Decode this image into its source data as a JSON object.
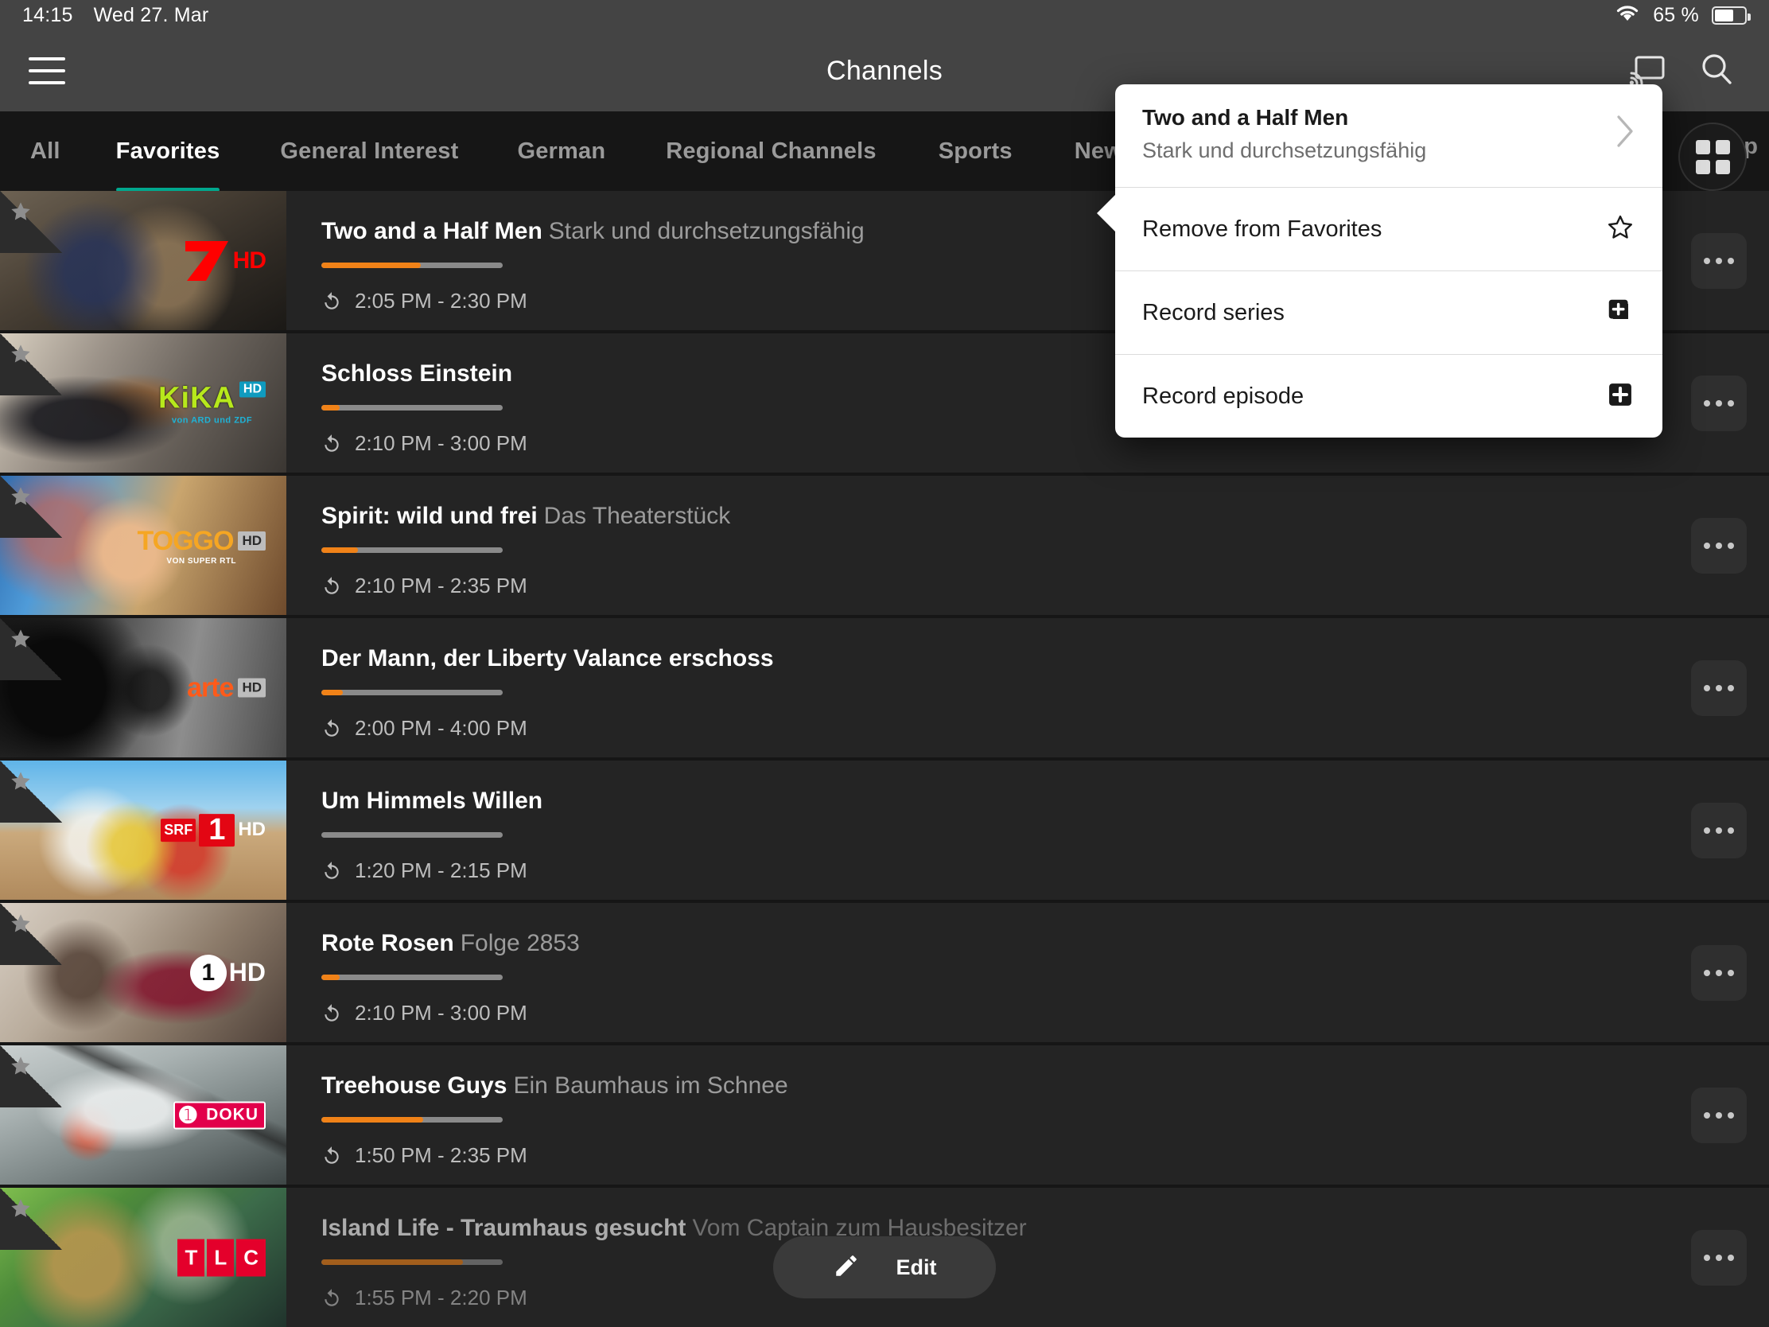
{
  "statusbar": {
    "time": "14:15",
    "date": "Wed 27. Mar",
    "battery_pct": "65 %",
    "wifi_icon": "wifi-icon",
    "battery_icon": "battery-icon"
  },
  "header": {
    "title": "Channels",
    "menu_icon": "hamburger-menu-icon",
    "cast_icon": "cast-icon",
    "search_icon": "search-icon"
  },
  "tabs": {
    "items": [
      {
        "label": "All",
        "active": false
      },
      {
        "label": "Favorites",
        "active": true
      },
      {
        "label": "General Interest",
        "active": false
      },
      {
        "label": "German",
        "active": false
      },
      {
        "label": "Regional Channels",
        "active": false
      },
      {
        "label": "Sports",
        "active": false
      },
      {
        "label": "News",
        "active": false
      }
    ],
    "overflow_label": "Sp",
    "grid_toggle_icon": "grid-view-icon",
    "accent_color": "#00a88e"
  },
  "list": {
    "rows": [
      {
        "title": "Two and a Half Men",
        "subtitle": "Stark und durchsetzungsfähig",
        "time": "2:05 PM - 2:30 PM",
        "progress_pct": 55,
        "channel": "pro7hd",
        "favorite_icon": "star-icon",
        "replay_icon": "replay-icon",
        "more_icon": "more-options-icon"
      },
      {
        "title": "Schloss Einstein",
        "subtitle": "",
        "time": "2:10 PM - 3:00 PM",
        "progress_pct": 10,
        "channel": "kikahd",
        "favorite_icon": "star-icon",
        "replay_icon": "replay-icon",
        "more_icon": "more-options-icon"
      },
      {
        "title": "Spirit: wild und frei",
        "subtitle": "Das Theaterstück",
        "time": "2:10 PM - 2:35 PM",
        "progress_pct": 20,
        "channel": "toggohd",
        "favorite_icon": "star-icon",
        "replay_icon": "replay-icon",
        "more_icon": "more-options-icon"
      },
      {
        "title": "Der Mann, der Liberty Valance erschoss",
        "subtitle": "",
        "time": "2:00 PM - 4:00 PM",
        "progress_pct": 12,
        "channel": "artehd",
        "favorite_icon": "star-icon",
        "replay_icon": "replay-icon",
        "more_icon": "more-options-icon"
      },
      {
        "title": "Um Himmels Willen",
        "subtitle": "",
        "time": "1:20 PM - 2:15 PM",
        "progress_pct": 0,
        "channel": "srf1hd",
        "favorite_icon": "star-icon",
        "replay_icon": "replay-icon",
        "more_icon": "more-options-icon"
      },
      {
        "title": "Rote Rosen",
        "subtitle": "Folge 2853",
        "time": "2:10 PM - 3:00 PM",
        "progress_pct": 10,
        "channel": "ardhd",
        "favorite_icon": "star-icon",
        "replay_icon": "replay-icon",
        "more_icon": "more-options-icon"
      },
      {
        "title": "Treehouse Guys",
        "subtitle": "Ein Baumhaus im Schnee",
        "time": "1:50 PM - 2:35 PM",
        "progress_pct": 56,
        "channel": "kabeleinsdoku",
        "favorite_icon": "star-icon",
        "replay_icon": "replay-icon",
        "more_icon": "more-options-icon"
      },
      {
        "title": "Island Life - Traumhaus gesucht",
        "subtitle": "Vom Captain zum Hausbesitzer",
        "time": "1:55 PM - 2:20 PM",
        "progress_pct": 78,
        "channel": "tlc",
        "favorite_icon": "star-icon",
        "replay_icon": "replay-icon",
        "more_icon": "more-options-icon"
      }
    ]
  },
  "popup": {
    "title": "Two and a Half Men",
    "subtitle": "Stark und durchsetzungsfähig",
    "chevron_icon": "chevron-right-icon",
    "items": [
      {
        "label": "Remove from Favorites",
        "icon": "star-outline-icon"
      },
      {
        "label": "Record series",
        "icon": "record-series-icon"
      },
      {
        "label": "Record episode",
        "icon": "record-episode-icon"
      }
    ]
  },
  "edit_fab": {
    "label": "Edit",
    "icon": "pencil-edit-icon"
  },
  "colors": {
    "accent_teal": "#00a88e",
    "progress_orange": "#f08218",
    "background": "#161616",
    "row_background": "#242424",
    "header_background": "#444444"
  },
  "channel_logos": {
    "pro7hd": {
      "name": "ProSieben HD",
      "hd": "HD"
    },
    "kikahd": {
      "name": "KiKA",
      "sub": "von ARD und ZDF",
      "hd": "HD"
    },
    "toggohd": {
      "name": "TOGGO",
      "sub": "VON SUPER RTL",
      "hd": "HD"
    },
    "artehd": {
      "name": "arte",
      "hd": "HD"
    },
    "srf1hd": {
      "name": "SRF",
      "num": "1",
      "hd": "HD"
    },
    "ardhd": {
      "name": "1",
      "hd": "HD"
    },
    "kabeleinsdoku": {
      "name": "DOKU"
    },
    "tlc": {
      "letters": [
        "T",
        "L",
        "C"
      ]
    }
  }
}
